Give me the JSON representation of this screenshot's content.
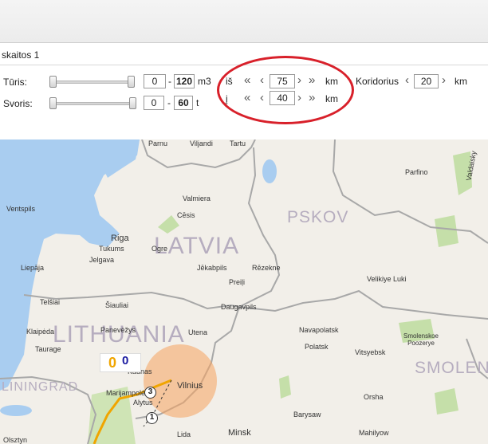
{
  "tab": {
    "label": "skaitos 1"
  },
  "filters": {
    "turis": {
      "label": "Tūris:",
      "min": "0",
      "max": "120",
      "unit": "m3"
    },
    "svoris": {
      "label": "Svoris:",
      "min": "0",
      "max": "60",
      "unit": "t"
    },
    "dash": "-",
    "is": {
      "label": "iš",
      "value": "75",
      "unit": "km"
    },
    "i": {
      "label": "į",
      "value": "40",
      "unit": "km"
    },
    "koridorius": {
      "label": "Koridorius",
      "value": "20",
      "unit": "km"
    },
    "arrows": {
      "first": "«",
      "prev": "‹",
      "next": "›",
      "last": "»"
    }
  },
  "map": {
    "countries": {
      "latvia": "LATVIA",
      "lithuania": "LITHUANIA",
      "pskov": "PSKOV",
      "smolensk": "SMOLENSK",
      "kaliningrad": "LININGRAD"
    },
    "cities": {
      "parnu": "Parnu",
      "viljandi": "Viljandi",
      "tartu": "Tartu",
      "parfino": "Parfino",
      "valdaisky": "Valdaisky",
      "ventspils": "Ventspils",
      "valmiera": "Valmiera",
      "cesis": "Cēsis",
      "riga": "Riga",
      "tukums": "Tukums",
      "jelgava": "Jelgava",
      "ogre": "Ogre",
      "liepaja": "Liepāja",
      "jekabpils": "Jēkabpils",
      "rezekne": "Rēzekne",
      "preili": "Preiļi",
      "velikiye_luki": "Velikiye Luki",
      "telsiai": "Telšiai",
      "siauliai": "Šiauliai",
      "daugavpils": "Daugavpils",
      "klaipeda": "Klaipėda",
      "panevezys": "Panevėžys",
      "utena": "Utena",
      "navapolatsk": "Navapolatsk",
      "polatsk": "Polatsk",
      "smolenskoe": "Smolenskoe Poozerye",
      "taurage": "Taurage",
      "vitsyebsk": "Vitsyebsk",
      "kaunas": "Kaunas",
      "vilnius": "Vilnius",
      "marijampole": "Marijampolė",
      "alytus": "Alytus",
      "orsha": "Orsha",
      "barysaw": "Barysaw",
      "minsk": "Minsk",
      "lida": "Lida",
      "mahilyow": "Mahilyow",
      "olsztyn": "Olsztyn"
    },
    "markers": {
      "count_orange": "0",
      "count_blue": "0",
      "pin_3": "3",
      "pin_1": "1"
    },
    "colors": {
      "land": "#f2efe9",
      "water": "#a9cdf0",
      "border": "#a8a8a8",
      "park": "#c5dfa9",
      "radius": "#f5a35f",
      "route": "#f0a500",
      "highlight_oval": "#d8202a"
    }
  }
}
